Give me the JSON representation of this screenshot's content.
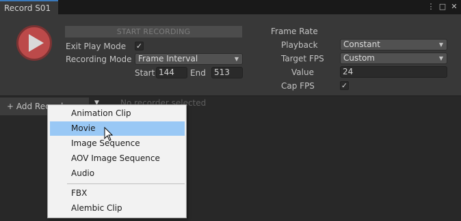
{
  "tab": {
    "title": "Record S01"
  },
  "window_icons": {
    "menu": "⋮",
    "maximize": "□",
    "close": "✕"
  },
  "recording": {
    "start_button": "START RECORDING",
    "exit_play_mode_label": "Exit Play Mode",
    "exit_play_mode_check": "✓",
    "recording_mode_label": "Recording Mode",
    "recording_mode_value": "Frame Interval",
    "start_label": "Start",
    "start_value": "144",
    "end_label": "End",
    "end_value": "513"
  },
  "frame_rate": {
    "heading": "Frame Rate",
    "playback_label": "Playback",
    "playback_value": "Constant",
    "target_fps_label": "Target FPS",
    "target_fps_value": "Custom",
    "value_label": "Value",
    "value_value": "24",
    "cap_fps_label": "Cap FPS",
    "cap_fps_check": "✓"
  },
  "recorders": {
    "add_button": "+ Add Recorder",
    "empty_text": "No recorder selected"
  },
  "menu": {
    "items": [
      "Animation Clip",
      "Movie",
      "Image Sequence",
      "AOV Image Sequence",
      "Audio",
      "FBX",
      "Alembic Clip"
    ],
    "highlighted": "Movie"
  },
  "colors": {
    "accent": "#3a79bb",
    "record": "#bc4a4a",
    "menu_highlight": "#99c8f5"
  }
}
